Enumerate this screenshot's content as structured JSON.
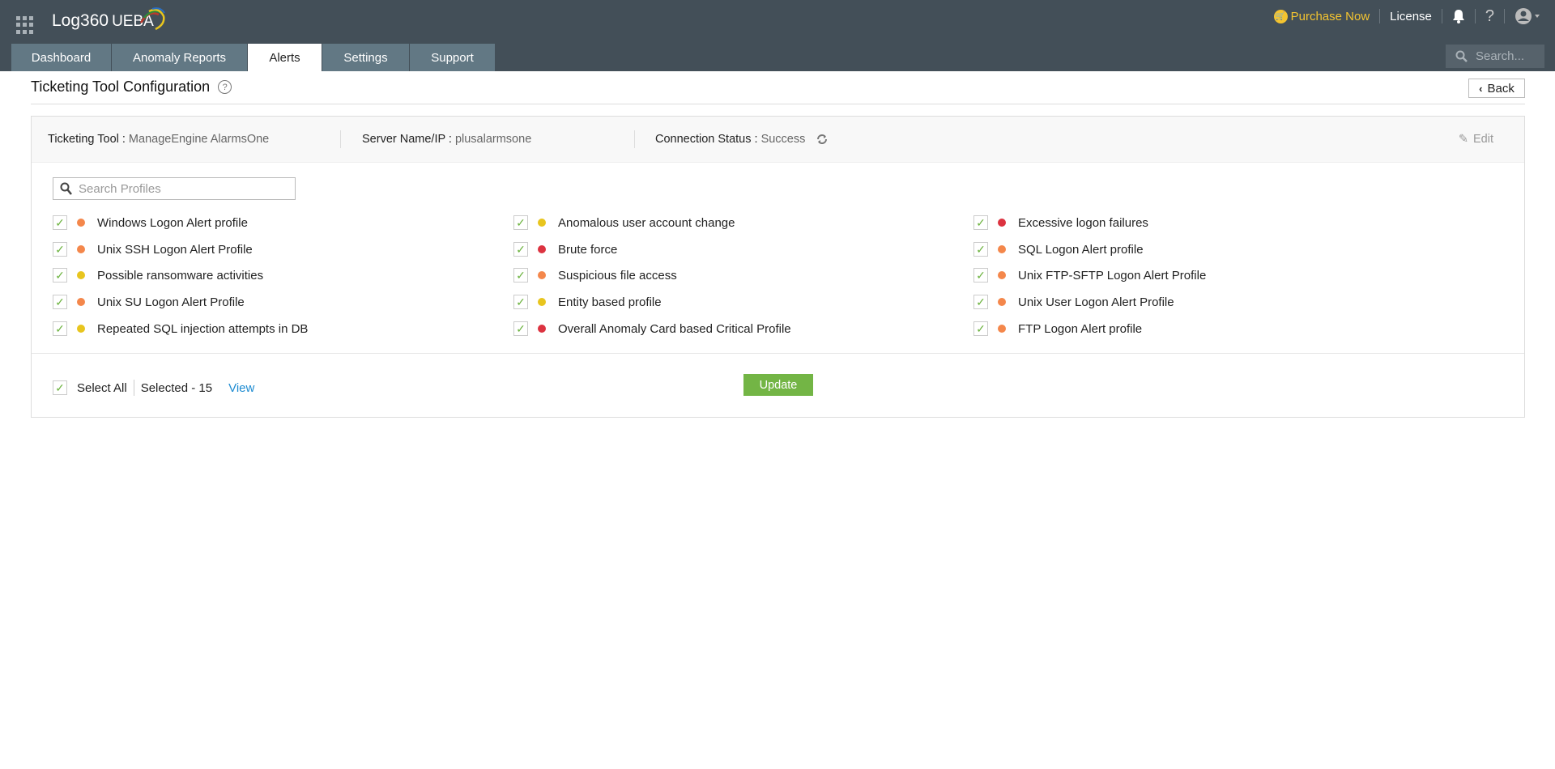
{
  "app": {
    "name": "Log360",
    "suffix": "UEBA"
  },
  "topbar": {
    "purchase": "Purchase Now",
    "license": "License",
    "help": "?"
  },
  "tabs": [
    {
      "label": "Dashboard"
    },
    {
      "label": "Anomaly Reports"
    },
    {
      "label": "Alerts"
    },
    {
      "label": "Settings"
    },
    {
      "label": "Support"
    }
  ],
  "search": {
    "placeholder": "Search..."
  },
  "page": {
    "title": "Ticketing Tool Configuration",
    "help": "?",
    "back": "Back"
  },
  "config": {
    "tool_label": "Ticketing Tool :",
    "tool_value": "ManageEngine AlarmsOne",
    "server_label": "Server Name/IP :",
    "server_value": "plusalarmsone",
    "status_label": "Connection Status :",
    "status_value": "Success",
    "edit": "Edit"
  },
  "profiles_search": {
    "placeholder": "Search Profiles"
  },
  "colors": {
    "orange": "#f4874b",
    "yellow": "#e8c51e",
    "red": "#dc3340"
  },
  "profiles": [
    [
      {
        "name": "Windows Logon Alert profile",
        "severity": "orange"
      },
      {
        "name": "Unix SSH Logon Alert Profile",
        "severity": "orange"
      },
      {
        "name": "Possible ransomware activities",
        "severity": "yellow"
      },
      {
        "name": "Unix SU Logon Alert Profile",
        "severity": "orange"
      },
      {
        "name": "Repeated SQL injection attempts in DB",
        "severity": "yellow"
      }
    ],
    [
      {
        "name": "Anomalous user account change",
        "severity": "yellow"
      },
      {
        "name": "Brute force",
        "severity": "red"
      },
      {
        "name": "Suspicious file access",
        "severity": "orange"
      },
      {
        "name": "Entity based profile",
        "severity": "yellow"
      },
      {
        "name": "Overall Anomaly Card based Critical Profile",
        "severity": "red"
      }
    ],
    [
      {
        "name": "Excessive logon failures",
        "severity": "red"
      },
      {
        "name": "SQL Logon Alert profile",
        "severity": "orange"
      },
      {
        "name": "Unix FTP-SFTP Logon Alert Profile",
        "severity": "orange"
      },
      {
        "name": "Unix User Logon Alert Profile",
        "severity": "orange"
      },
      {
        "name": "FTP Logon Alert profile",
        "severity": "orange"
      }
    ]
  ],
  "footer": {
    "select_all": "Select All",
    "selected": "Selected - 15",
    "view": "View",
    "update": "Update"
  }
}
